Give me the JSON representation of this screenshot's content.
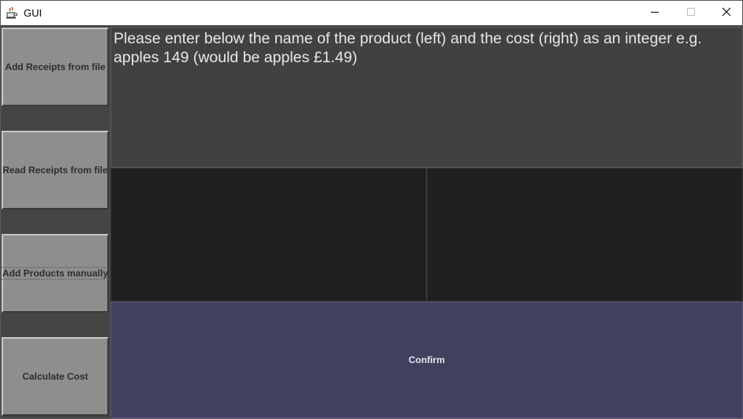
{
  "window": {
    "title": "GUI",
    "app_icon": "java-cup-icon",
    "controls": [
      "minimize-icon",
      "maximize-icon",
      "close-icon"
    ]
  },
  "sidebar": {
    "buttons": [
      {
        "label": "Add Receipts from file"
      },
      {
        "label": "Read Receipts from file"
      },
      {
        "label": "Add Products manually"
      },
      {
        "label": "Calculate Cost"
      }
    ]
  },
  "main": {
    "instructions": "Please enter below the name of the product (left) and the cost (right) as an integer e.g. apples 149 (would be apples £1.49)",
    "product_name_value": "",
    "product_cost_value": "",
    "confirm_label": "Confirm"
  },
  "colors": {
    "background": "#454545",
    "button": "#8e8e8e",
    "text_field": "#202020",
    "confirm": "#40405f"
  }
}
